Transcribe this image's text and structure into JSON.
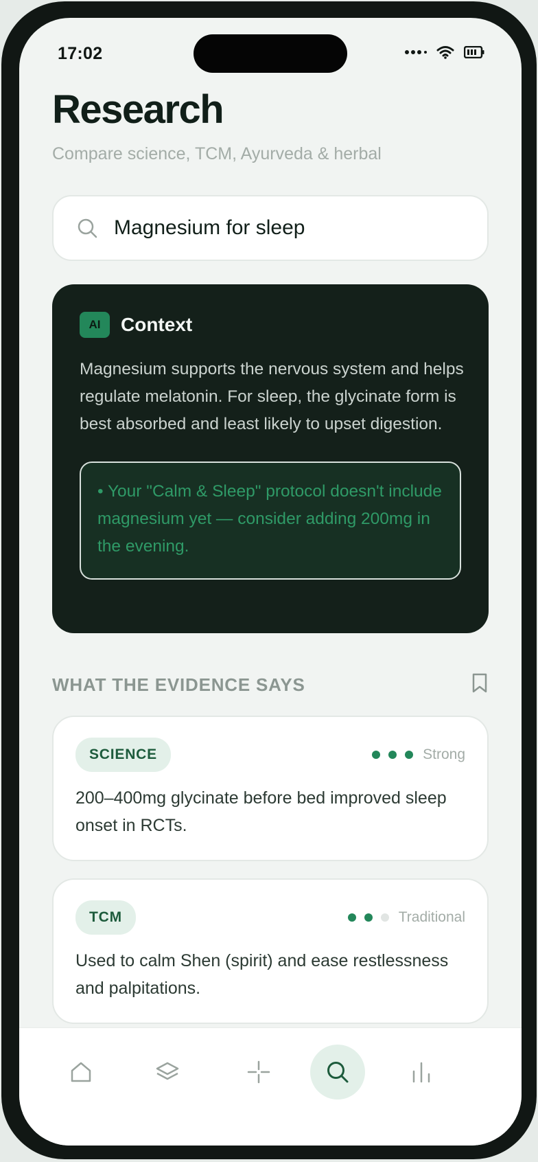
{
  "status_bar": {
    "time": "17:02"
  },
  "header": {
    "title": "Research",
    "subtitle": "Compare science, TCM, Ayurveda & herbal"
  },
  "search": {
    "value": "Magnesium for sleep",
    "icon": "search-icon"
  },
  "ai_context": {
    "badge": "AI",
    "title": "Context",
    "body": "Magnesium supports the nervous system and helps regulate melatonin. For sleep, the glycinate form is best absorbed and least likely to upset digestion.",
    "note": "• Your \"Calm & Sleep\" protocol doesn't include magnesium yet — consider adding 200mg in the evening."
  },
  "evidence": {
    "section_title": "WHAT THE EVIDENCE SAYS",
    "items": [
      {
        "tag": "SCIENCE",
        "rating_level": 3,
        "rating_max": 3,
        "rating_label": "Strong",
        "text": "200–400mg glycinate before bed improved sleep onset in RCTs."
      },
      {
        "tag": "TCM",
        "rating_level": 2,
        "rating_max": 3,
        "rating_label": "Traditional",
        "text": "Used to calm Shen (spirit) and ease restlessness and palpitations."
      }
    ]
  },
  "tabbar": {
    "items": [
      "home-icon",
      "layers-icon",
      "sparkle-icon",
      "search-icon",
      "stats-icon"
    ],
    "active": "search-icon"
  },
  "colors": {
    "accent": "#23875a",
    "card_dark": "#14201a",
    "background": "#f1f4f2"
  }
}
